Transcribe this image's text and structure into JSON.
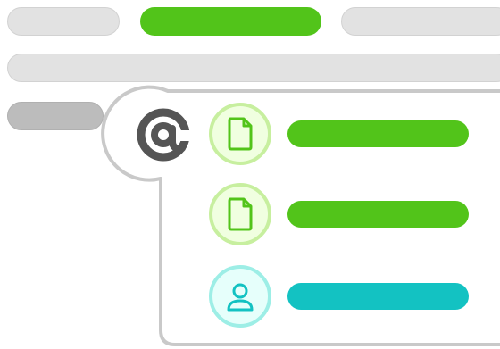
{
  "colors": {
    "placeholder_grey": "#e2e2e2",
    "placeholder_dark_grey": "#bcbcbc",
    "accent_green": "#52c41a",
    "accent_teal": "#13c2c2",
    "popup_border": "#c9c9c9",
    "at_symbol": "#555555"
  },
  "editor": {
    "top_row": [
      {
        "name": "placeholder-pill-left",
        "style": "grey"
      },
      {
        "name": "placeholder-pill-center-highlight",
        "style": "green"
      },
      {
        "name": "placeholder-pill-right",
        "style": "grey"
      }
    ],
    "second_row": {
      "name": "placeholder-line-full",
      "style": "grey"
    },
    "third_row": {
      "name": "placeholder-pill-short",
      "style": "dark-grey"
    }
  },
  "mention_popup": {
    "trigger_icon": "at-sign-icon",
    "items": [
      {
        "type": "file",
        "icon": "file-icon",
        "accent": "green"
      },
      {
        "type": "file",
        "icon": "file-icon",
        "accent": "green"
      },
      {
        "type": "user",
        "icon": "user-icon",
        "accent": "teal"
      }
    ]
  }
}
